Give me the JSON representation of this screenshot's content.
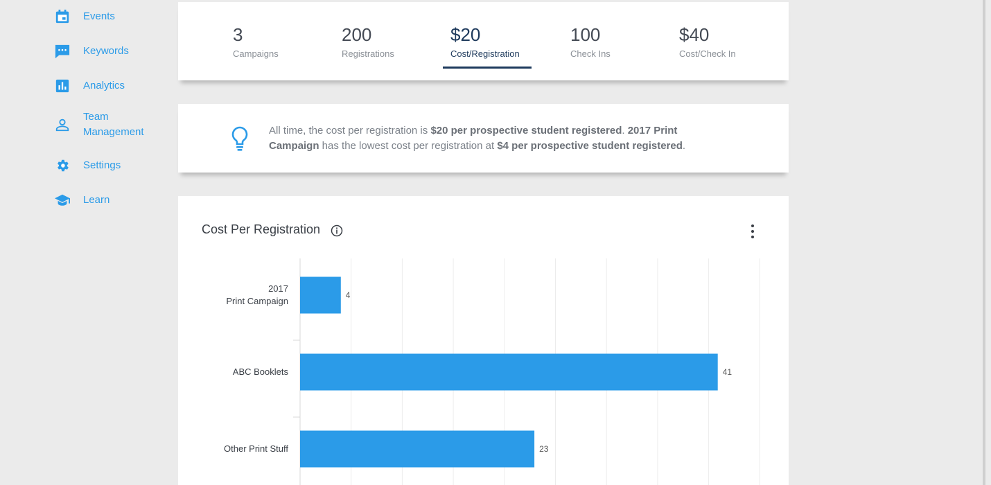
{
  "sidebar": {
    "items": [
      {
        "label": "Events",
        "icon": "calendar-icon"
      },
      {
        "label": "Keywords",
        "icon": "chat-icon"
      },
      {
        "label": "Analytics",
        "icon": "bar-chart-icon"
      },
      {
        "label": "Team Management",
        "label_line1": "Team",
        "label_line2": "Management",
        "icon": "person-icon"
      },
      {
        "label": "Settings",
        "icon": "gear-icon"
      },
      {
        "label": "Learn",
        "icon": "graduation-cap-icon"
      }
    ],
    "accent_color": "#2b9be8"
  },
  "stats": [
    {
      "value": "3",
      "label": "Campaigns"
    },
    {
      "value": "200",
      "label": "Registrations"
    },
    {
      "value": "$20",
      "label": "Cost/Registration",
      "active": true
    },
    {
      "value": "100",
      "label": "Check Ins"
    },
    {
      "value": "$40",
      "label": "Cost/Check In"
    }
  ],
  "insight": {
    "t1": "All time, the cost per registration is ",
    "b1": "$20 per prospective student registered",
    "t2": ". ",
    "b2": "2017 Print Campaign",
    "t3": " has the lowest cost per registration at ",
    "b3": "$4 per prospective student registered",
    "t4": "."
  },
  "chart_card": {
    "title": "Cost Per Registration"
  },
  "chart_data": {
    "type": "bar",
    "orientation": "horizontal",
    "title": "Cost Per Registration",
    "categories": [
      "2017 Print Campaign",
      "ABC Booklets",
      "Other Print Stuff"
    ],
    "category_lines": [
      [
        "2017",
        "Print Campaign"
      ],
      [
        "ABC Booklets"
      ],
      [
        "Other Print Stuff"
      ]
    ],
    "values": [
      4,
      41,
      23
    ],
    "xlim": [
      0,
      45
    ],
    "grid": true,
    "bar_color": "#2b9be8"
  }
}
